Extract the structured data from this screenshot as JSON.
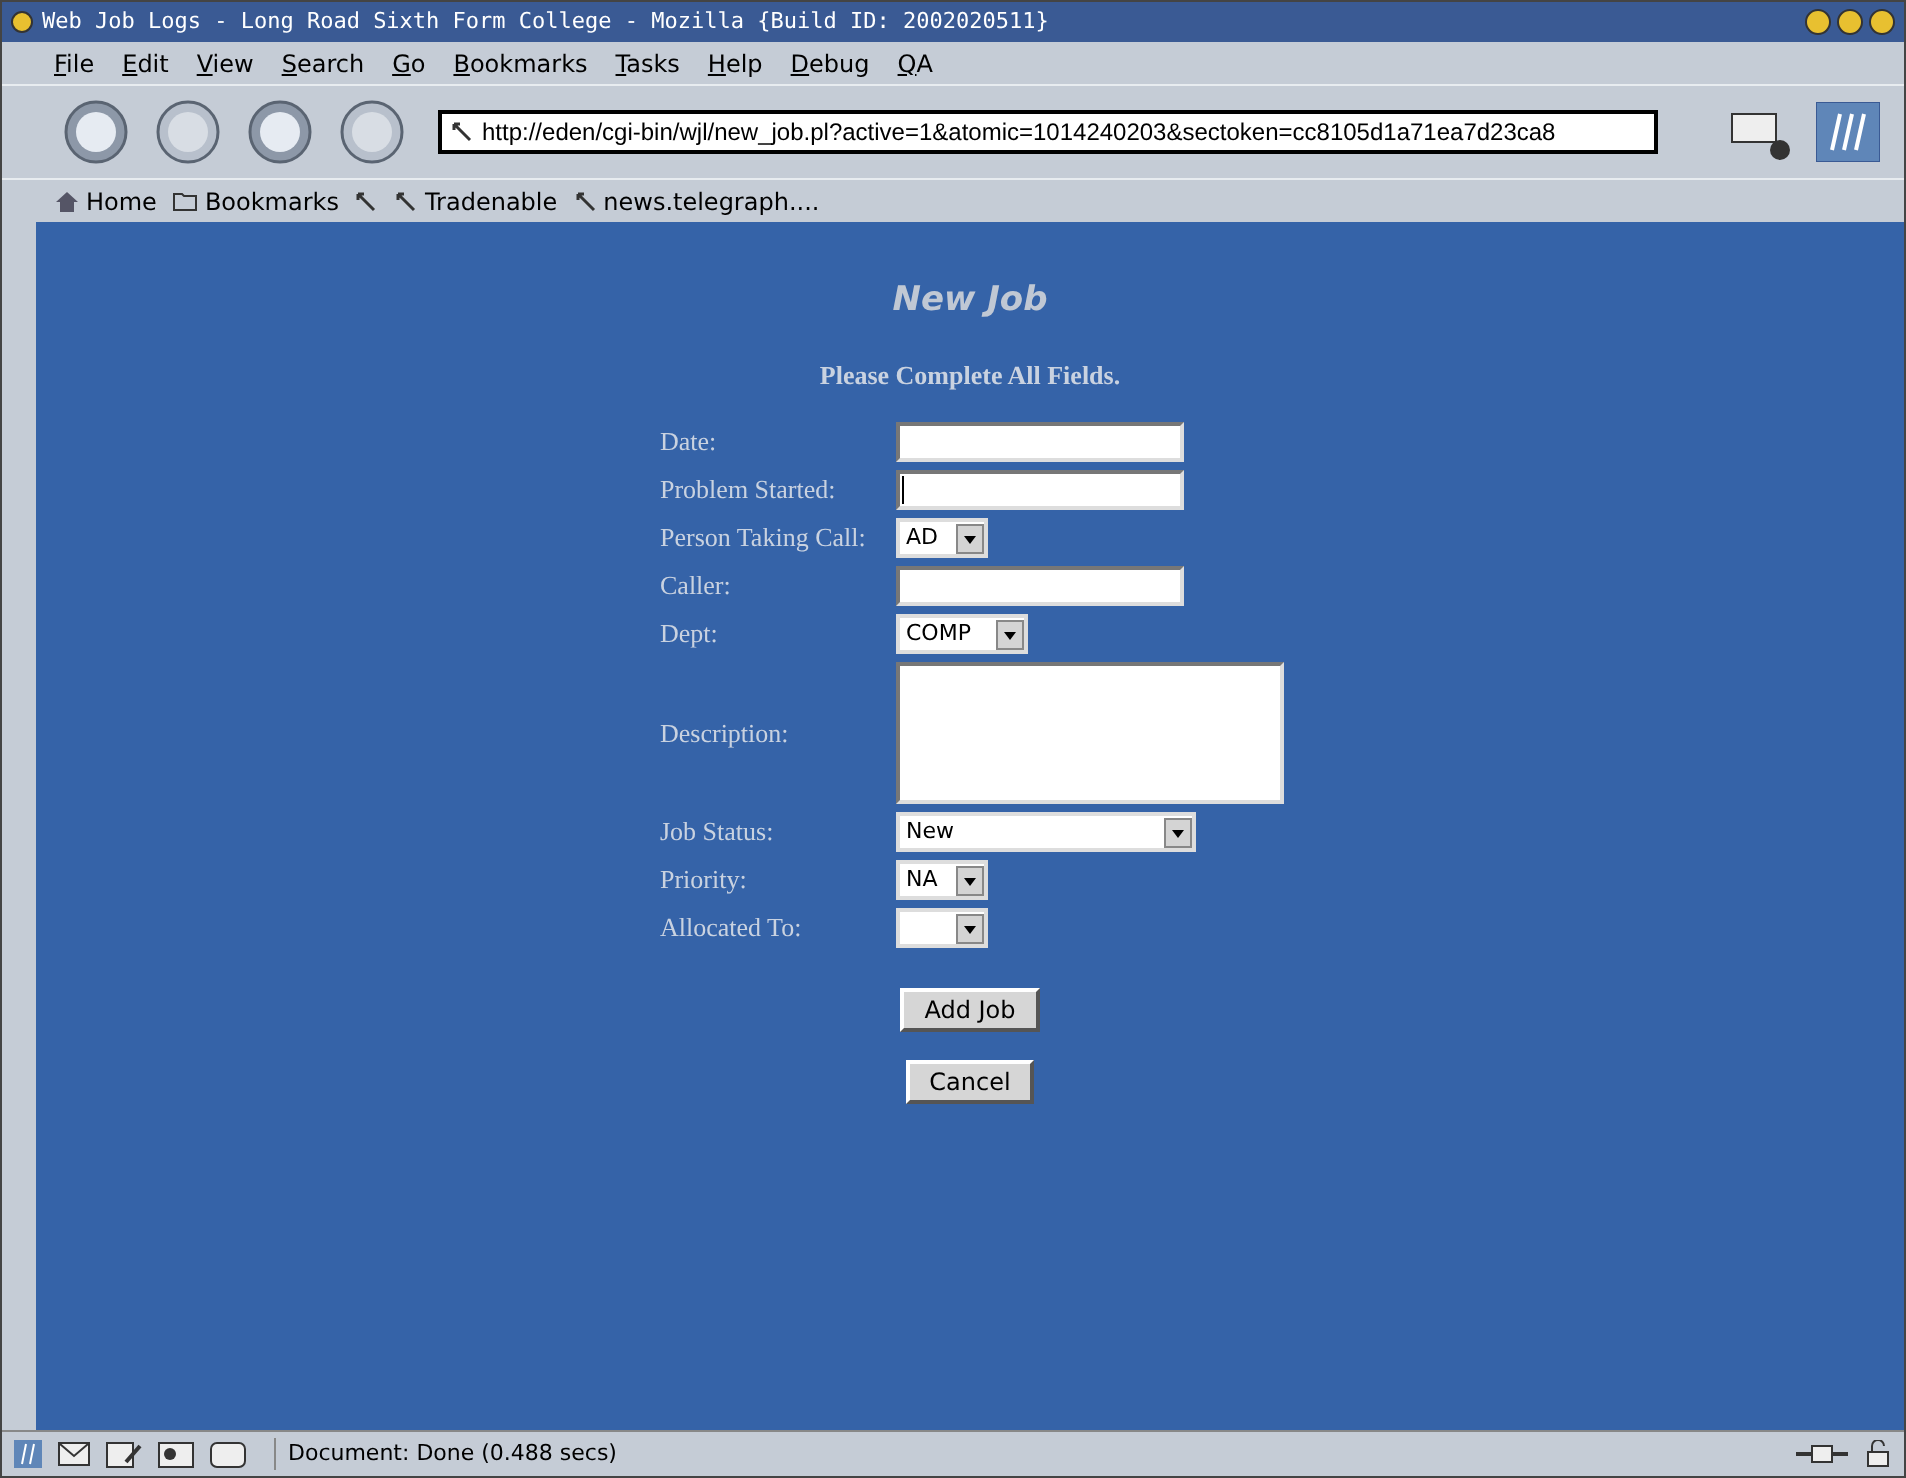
{
  "window": {
    "title": "Web Job Logs - Long Road Sixth Form College - Mozilla {Build ID: 2002020511}"
  },
  "menu": [
    "File",
    "Edit",
    "View",
    "Search",
    "Go",
    "Bookmarks",
    "Tasks",
    "Help",
    "Debug",
    "QA"
  ],
  "url": "http://eden/cgi-bin/wjl/new_job.pl?active=1&atomic=1014240203&sectoken=cc8105d1a71ea7d23ca8",
  "personal_bar": [
    {
      "kind": "home",
      "label": "Home"
    },
    {
      "kind": "folder",
      "label": "Bookmarks"
    },
    {
      "kind": "link"
    },
    {
      "kind": "link",
      "label": "Tradenable"
    },
    {
      "kind": "link",
      "label": "news.telegraph...."
    }
  ],
  "page": {
    "heading": "New Job",
    "subheading": "Please Complete All Fields.",
    "fields": [
      {
        "label": "Date:",
        "kind": "text"
      },
      {
        "label": "Problem Started:",
        "kind": "text",
        "focused": true
      },
      {
        "label": "Person Taking Call:",
        "kind": "select",
        "value": "AD"
      },
      {
        "label": "Caller:",
        "kind": "text"
      },
      {
        "label": "Dept:",
        "kind": "select",
        "value": "COMP"
      },
      {
        "label": "Description:",
        "kind": "textarea"
      },
      {
        "label": "Job Status:",
        "kind": "select",
        "value": "New"
      },
      {
        "label": "Priority:",
        "kind": "select",
        "value": "NA"
      },
      {
        "label": "Allocated To:",
        "kind": "select"
      }
    ],
    "buttons": [
      "Add Job",
      "Cancel"
    ]
  },
  "status_bar": {
    "text": "Document: Done (0.488 secs)"
  }
}
